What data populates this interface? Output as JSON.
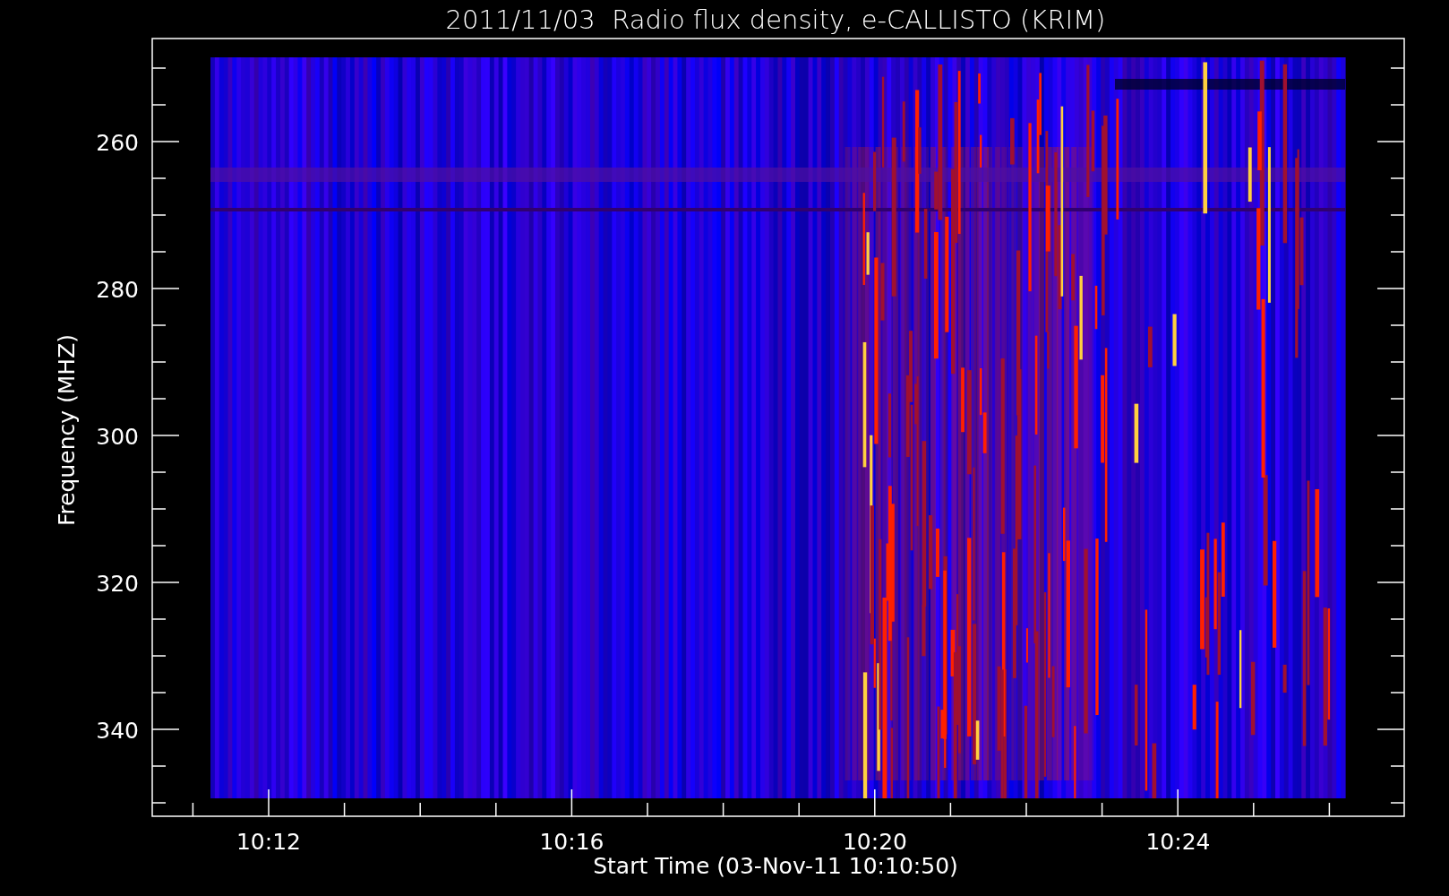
{
  "plot": {
    "title": "2011/11/03  Radio flux density, e-CALLISTO (KRIM)",
    "ylabel": "Frequency (MHZ)",
    "xlabel": "Start Time (03-Nov-11 10:10:50)",
    "yticks": [
      "260",
      "280",
      "300",
      "320",
      "340"
    ],
    "xticks": [
      "10:12",
      "10:16",
      "10:20",
      "10:24"
    ]
  }
}
